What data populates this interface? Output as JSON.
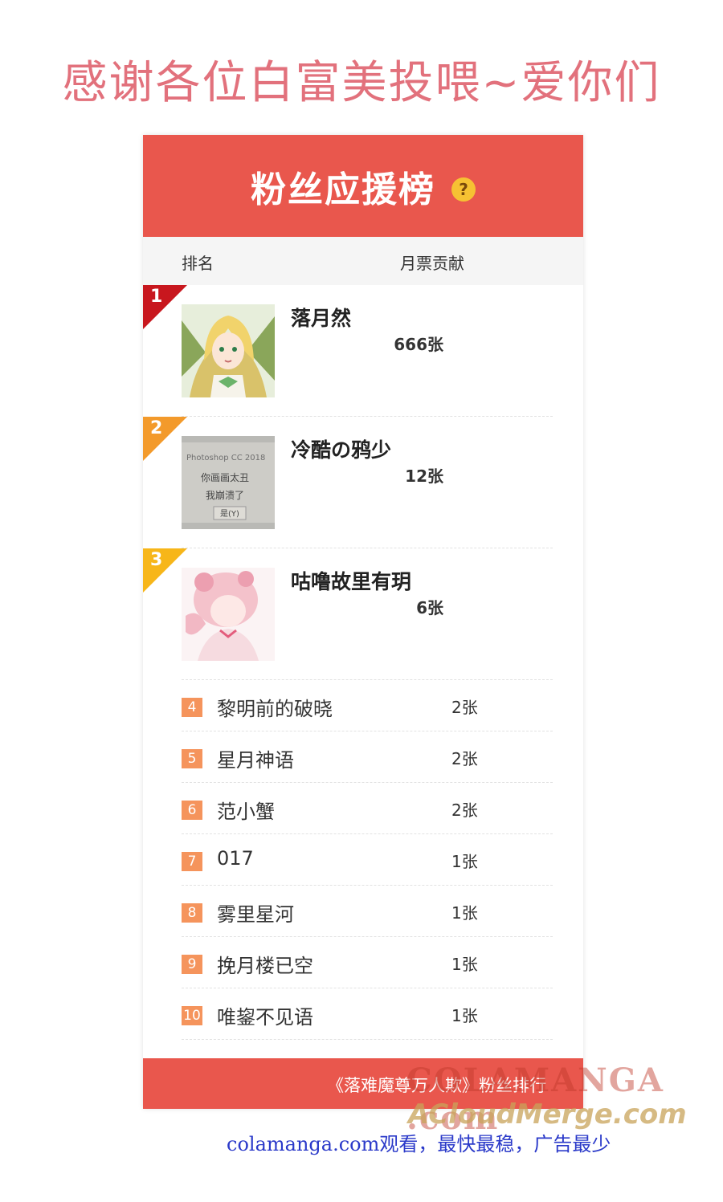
{
  "thanks_text": "感谢各位白富美投喂~爱你们",
  "panel": {
    "title": "粉丝应援榜",
    "help_glyph": "?",
    "col_rank": "排名",
    "col_votes": "月票贡献",
    "top3": [
      {
        "rank": "1",
        "name": "落月然",
        "votes": "666张",
        "avatar": "green-haired-fairy-avatar"
      },
      {
        "rank": "2",
        "name": "冷酷の鸦少",
        "votes": "12张",
        "avatar": "photoshop-dialog-photo-avatar",
        "avatar_text": [
          "Photoshop CC 2018",
          "你画画太丑",
          "我崩溃了",
          "是(Y)"
        ]
      },
      {
        "rank": "3",
        "name": "咕噜故里有玥",
        "votes": "6张",
        "avatar": "pink-anime-girl-avatar"
      }
    ],
    "list": [
      {
        "rank": "4",
        "name": "黎明前的破晓",
        "votes": "2张"
      },
      {
        "rank": "5",
        "name": "星月神语",
        "votes": "2张"
      },
      {
        "rank": "6",
        "name": "范小蟹",
        "votes": "2张"
      },
      {
        "rank": "7",
        "name": "017",
        "votes": "1张"
      },
      {
        "rank": "8",
        "name": "雾里星河",
        "votes": "1张"
      },
      {
        "rank": "9",
        "name": "挽月楼已空",
        "votes": "1张"
      },
      {
        "rank": "10",
        "name": "唯鋆不见语",
        "votes": "1张"
      }
    ],
    "footer_link": "《落难魔尊万人欺》粉丝排行"
  },
  "watermark_1": "COLAMANGA .com",
  "watermark_2": "ACloudMerge.com",
  "bottom_text": "colamanga.com观看，最快最稳，广告最少",
  "colors": {
    "banner": "#e9574d",
    "rank1": "#c8171e",
    "rank2": "#f39a2b",
    "rank3": "#f7b619",
    "badge": "#f5945c",
    "thanks": "#e2717c",
    "bottom_text": "#2a39c9"
  }
}
